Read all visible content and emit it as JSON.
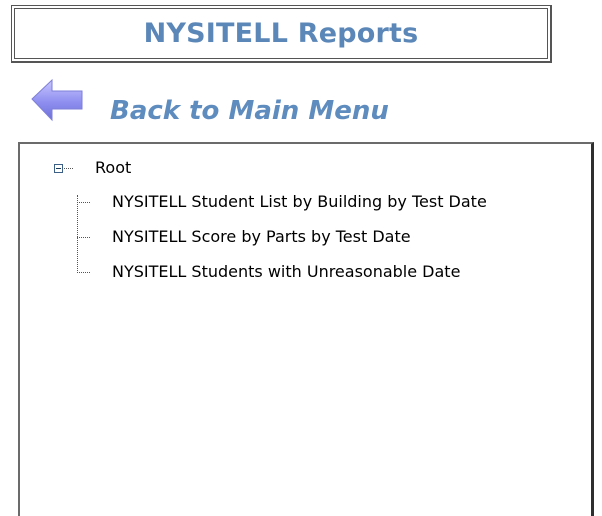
{
  "header": {
    "title": "NYSITELL Reports"
  },
  "navigation": {
    "back_label": "Back to Main Menu",
    "back_icon": "back-arrow-icon",
    "accent_color": "#5e8cbf"
  },
  "tree": {
    "root_label": "Root",
    "expanded": true,
    "items": [
      {
        "label": "NYSITELL Student List by Building by Test Date"
      },
      {
        "label": "NYSITELL Score by Parts by Test Date"
      },
      {
        "label": "NYSITELL Students with Unreasonable Date"
      }
    ]
  }
}
